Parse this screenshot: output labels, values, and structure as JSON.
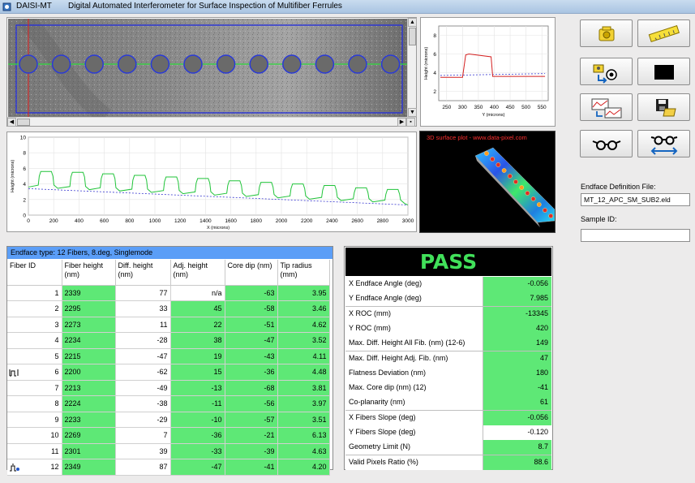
{
  "window": {
    "app_name": "DAISI-MT",
    "title": "Digital Automated Interferometer for Surface Inspection of Multifiber Ferrules"
  },
  "profile_y_chart": {
    "type": "line",
    "x_ticks": [
      "250",
      "300",
      "350",
      "400",
      "450",
      "500",
      "550"
    ],
    "y_ticks": [
      "8",
      "6",
      "4",
      "2"
    ],
    "xlabel": "Y (microns)",
    "ylabel": "Height (microns)",
    "x": [
      230,
      300,
      310,
      320,
      390,
      395,
      410,
      560
    ],
    "y": [
      3.5,
      3.5,
      5.9,
      6.0,
      5.7,
      3.6,
      3.6,
      3.6
    ]
  },
  "profile_x_chart": {
    "type": "line",
    "x_ticks": [
      "0",
      "200",
      "400",
      "600",
      "800",
      "1000",
      "1200",
      "1400",
      "1600",
      "1800",
      "2000",
      "2200",
      "2400",
      "2600",
      "2800",
      "3000"
    ],
    "y_ticks": [
      "10",
      "8",
      "6",
      "4",
      "2",
      "0"
    ],
    "xlabel": "X (microns)",
    "ylabel": "Height (microns)",
    "peaks_x": [
      140,
      390,
      630,
      880,
      1130,
      1380,
      1630,
      1880,
      2130,
      2380,
      2630,
      2880
    ],
    "peak_height": [
      5.6,
      5.5,
      5.3,
      5.1,
      4.9,
      4.7,
      4.4,
      4.2,
      4.0,
      3.8,
      3.5,
      3.3
    ],
    "baseline_start": 3.4,
    "baseline_end": 1.3
  },
  "surface_plot": {
    "label": "3D surface plot - www.data-pixel.com"
  },
  "sidebar": {
    "definition_label": "Endface Definition File:",
    "definition_value": "MT_12_APC_SM_SUB2.eld",
    "sample_label": "Sample ID:",
    "sample_value": ""
  },
  "toolbar": {
    "buttons": [
      "camera-icon",
      "ruler-icon",
      "camera-swap-icon",
      "black-square-icon",
      "profile-swap-icon",
      "save-icon",
      "glasses-icon",
      "glasses-swap-icon"
    ]
  },
  "fiber_table": {
    "endface_type": "Endface type: 12 Fibers, 8.deg, Singlemode",
    "headers": [
      "Fiber ID",
      "Fiber height (nm)",
      "Diff. height (nm)",
      "Adj. height (nm)",
      "Core dip (nm)",
      "Tip radius (mm)"
    ],
    "rows": [
      [
        "1",
        "2339",
        "77",
        "n/a",
        "-63",
        "3.95"
      ],
      [
        "2",
        "2295",
        "33",
        "45",
        "-58",
        "3.46"
      ],
      [
        "3",
        "2273",
        "11",
        "22",
        "-51",
        "4.62"
      ],
      [
        "4",
        "2234",
        "-28",
        "38",
        "-47",
        "3.52"
      ],
      [
        "5",
        "2215",
        "-47",
        "19",
        "-43",
        "4.11"
      ],
      [
        "6",
        "2200",
        "-62",
        "15",
        "-36",
        "4.48"
      ],
      [
        "7",
        "2213",
        "-49",
        "-13",
        "-68",
        "3.81"
      ],
      [
        "8",
        "2224",
        "-38",
        "-11",
        "-56",
        "3.97"
      ],
      [
        "9",
        "2233",
        "-29",
        "-10",
        "-57",
        "3.51"
      ],
      [
        "10",
        "2269",
        "7",
        "-36",
        "-21",
        "6.13"
      ],
      [
        "11",
        "2301",
        "39",
        "-33",
        "-39",
        "4.63"
      ],
      [
        "12",
        "2349",
        "87",
        "-47",
        "-41",
        "4.20"
      ]
    ],
    "white_cells": [
      [
        0,
        2
      ],
      [
        0,
        3
      ],
      [
        1,
        2
      ],
      [
        2,
        2
      ],
      [
        3,
        2
      ],
      [
        4,
        2
      ],
      [
        5,
        2
      ],
      [
        6,
        2
      ],
      [
        7,
        2
      ],
      [
        8,
        2
      ],
      [
        9,
        2
      ],
      [
        10,
        2
      ],
      [
        11,
        2
      ]
    ]
  },
  "results": {
    "status": "PASS",
    "rows": [
      {
        "label": "X Endface Angle (deg)",
        "value": "-0.056",
        "state": "green"
      },
      {
        "label": "Y Endface Angle (deg)",
        "value": "7.985",
        "state": "green"
      },
      {
        "label": "X ROC (mm)",
        "value": "-13345",
        "state": "green"
      },
      {
        "label": "Y ROC (mm)",
        "value": "420",
        "state": "green"
      },
      {
        "label": "Max. Diff. Height All Fib. (nm) (12-6)",
        "value": "149",
        "state": "green"
      },
      {
        "label": "Max. Diff. Height Adj. Fib. (nm)",
        "value": "47",
        "state": "green"
      },
      {
        "label": "Flatness Deviation (nm)",
        "value": "180",
        "state": "green"
      },
      {
        "label": "Max. Core dip (nm) (12)",
        "value": "-41",
        "state": "green"
      },
      {
        "label": "Co-planarity (nm)",
        "value": "61",
        "state": "green"
      },
      {
        "label": "X Fibers Slope (deg)",
        "value": "-0.056",
        "state": "green"
      },
      {
        "label": "Y Fibers Slope (deg)",
        "value": "-0.120",
        "state": "white"
      },
      {
        "label": "Geometry Limit (N)",
        "value": "8.7",
        "state": "green"
      },
      {
        "label": "Valid Pixels Ratio (%)",
        "value": "88.6",
        "state": "green"
      }
    ]
  }
}
